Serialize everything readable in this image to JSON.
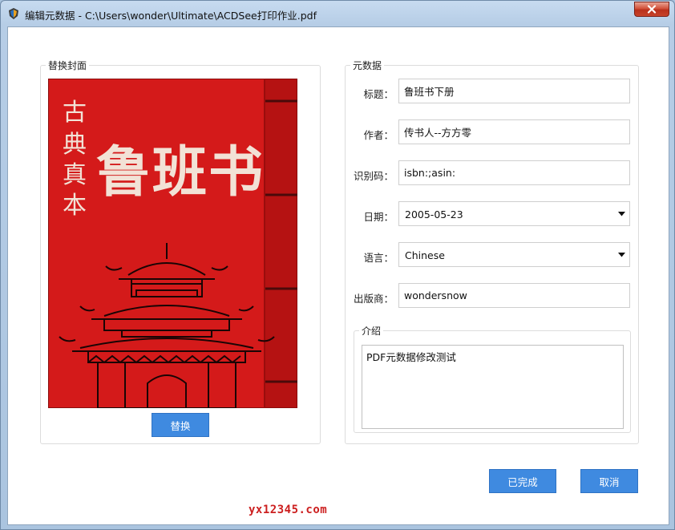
{
  "window": {
    "title": "编辑元数据 - C:\\Users\\wonder\\Ultimate\\ACDSee打印作业.pdf"
  },
  "cover_group": {
    "title": "替换封面",
    "cover_text_vertical": "古典真本",
    "cover_text_main": "鲁班书",
    "replace_button": "替换"
  },
  "metadata_group": {
    "title": "元数据",
    "fields": {
      "title": {
        "label": "标题：",
        "value": "鲁班书下册"
      },
      "author": {
        "label": "作者：",
        "value": "传书人--方方零"
      },
      "identifier": {
        "label": "识别码：",
        "value": "isbn:;asin:"
      },
      "date": {
        "label": "日期：",
        "value": "2005-05-23"
      },
      "language": {
        "label": "语言：",
        "value": "Chinese"
      },
      "publisher": {
        "label": "出版商：",
        "value": "wondersnow"
      }
    },
    "intro": {
      "title": "介绍",
      "value": "PDF元数据修改测试"
    }
  },
  "actions": {
    "done": "已完成",
    "cancel": "取消"
  },
  "watermark": "yx12345.com",
  "colors": {
    "accent_button": "#3f8ae0",
    "cover_red": "#d41a1a",
    "close_button": "#c7432b"
  }
}
